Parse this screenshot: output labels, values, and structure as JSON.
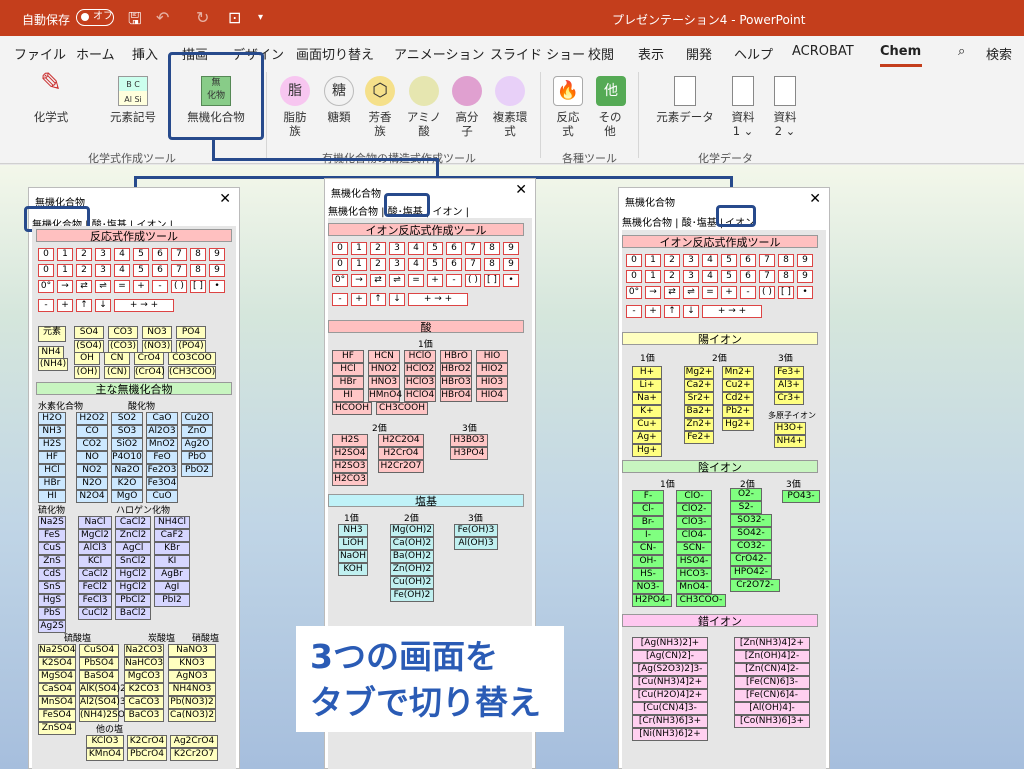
{
  "window": {
    "autosave_label": "自動保存",
    "autosave_state": "オフ",
    "title": "プレゼンテーション4 - PowerPoint"
  },
  "menu": [
    "ファイル",
    "ホーム",
    "挿入",
    "描画",
    "デザイン",
    "画面切り替え",
    "アニメーション",
    "スライド ショー",
    "校閲",
    "表示",
    "開発",
    "ヘルプ",
    "ACROBAT",
    "Chem",
    "検索"
  ],
  "ribbon": {
    "kagakushiki": "化学式",
    "genso_kigo": "元素記号",
    "muki": "無機化合物",
    "shibo": "脂肪",
    "shibo2": "族",
    "touruui": "糖類",
    "houkou": "芳香",
    "houkou2": "族",
    "amino": "アミノ",
    "amino2": "酸",
    "koubun": "高分",
    "koubun2": "子",
    "fukuso": "複素環",
    "fukuso2": "式",
    "hannou": "反応",
    "hannou2": "式",
    "sonota": "その",
    "sonota2": "他",
    "genso_data": "元素データ",
    "shiryo1": "資料",
    "shiryo1n": "1",
    "shiryo2": "資料",
    "shiryo2n": "2",
    "grp1": "化学式作成ツール",
    "grp2": "有機化合物の構造式作成ツール",
    "grp3": "各種ツール",
    "grp4": "化学データ",
    "ic_bc": "B C",
    "ic_alsi": "Al Si",
    "ic_muki": "無\n化物",
    "ic_shibo": "脂",
    "ic_tou": "糖",
    "ic_sonota": "他"
  },
  "pane1": {
    "title": "無機化合物",
    "tabs": "無機化合物 | 酸･塩基 | イオン |",
    "h1": "反応式作成ツール",
    "h2": "主な無機化合物",
    "keys": [
      "0",
      "1",
      "2",
      "3",
      "4",
      "5",
      "6",
      "7",
      "8",
      "9"
    ],
    "sym": [
      "0°",
      "→",
      "⇄",
      "⇌",
      "=",
      "+",
      "-",
      "( )",
      "[ ]",
      "•"
    ],
    "ops": [
      "-",
      "+",
      "↑",
      "↓",
      "+  →  +"
    ],
    "genso": "元素",
    "nh4": "NH4",
    "nh4p": "(NH4)",
    "ions": [
      "SO4",
      "CO3",
      "NO3",
      "PO4",
      "(SO4)",
      "(CO3)",
      "(NO3)",
      "(PO4)",
      "OH",
      "CN",
      "CrO4",
      "CO3COO",
      "(OH)",
      "(CN)",
      "(CrO4)",
      "(CH3COO)"
    ],
    "l_suiso": "水素化合物",
    "l_sanka": "酸化物",
    "l_ryuka": "硫化物",
    "l_halogen": "ハロゲン化物",
    "l_ryusan": "硫酸塩",
    "l_tansan": "炭酸塩",
    "l_shousan": "硝酸塩",
    "l_other": "他の塩",
    "suiso": [
      "H2O",
      "NH3",
      "H2S",
      "HF",
      "HCl",
      "HBr",
      "HI"
    ],
    "sanka": [
      "H2O2",
      "SO2",
      "CaO",
      "Cu2O",
      "CO",
      "SO3",
      "Al2O3",
      "ZnO",
      "CO2",
      "SiO2",
      "MnO2",
      "Ag2O",
      "NO",
      "P4O10",
      "FeO",
      "PbO",
      "NO2",
      "Na2O",
      "Fe2O3",
      "PbO2",
      "N2O",
      "K2O",
      "Fe3O4",
      "",
      "N2O4",
      "MgO",
      "CuO",
      ""
    ],
    "ryuka": [
      "Na2S",
      "FeS",
      "CuS",
      "ZnS",
      "CdS",
      "SnS",
      "HgS",
      "PbS",
      "Ag2S"
    ],
    "halogen": [
      "NaCl",
      "CaCl2",
      "NH4Cl",
      "MgCl2",
      "ZnCl2",
      "CaF2",
      "AlCl3",
      "AgCl",
      "KBr",
      "KCl",
      "SnCl2",
      "KI",
      "CaCl2",
      "HgCl2",
      "AgBr",
      "FeCl2",
      "HgCl2",
      "AgI",
      "FeCl3",
      "PbCl2",
      "PbI2",
      "CuCl2",
      "BaCl2",
      ""
    ],
    "ryusan": [
      "Na2SO4",
      "CuSO4",
      "K2SO4",
      "PbSO4",
      "MgSO4",
      "BaSO4",
      "CaSO4",
      "AlK(SO4)2",
      "MnSO4",
      "Al2(SO4)3",
      "FeSO4",
      "(NH4)2SO4",
      "ZnSO4",
      ""
    ],
    "tansan": [
      "Na2CO3",
      "NaHCO3",
      "MgCO3",
      "K2CO3",
      "CaCO3",
      "BaCO3"
    ],
    "shousan": [
      "NaNO3",
      "KNO3",
      "AgNO3",
      "NH4NO3",
      "Pb(NO3)2",
      "Ca(NO3)2"
    ],
    "other": [
      "KClO3",
      "K2CrO4",
      "Ag2CrO4",
      "KMnO4",
      "PbCrO4",
      "K2Cr2O7"
    ]
  },
  "pane2": {
    "title": "無機化合物",
    "tabs": "無機化合物 | 酸･塩基 | イオン |",
    "h1": "イオン反応式作成ツール",
    "h2": "酸",
    "h3": "塩基",
    "v1": "1価",
    "v2": "2価",
    "v3": "3価",
    "acid1": [
      "HF",
      "HCN",
      "HClO",
      "HBrO",
      "HIO",
      "HCl",
      "HNO2",
      "HClO2",
      "HBrO2",
      "HIO2",
      "HBr",
      "HNO3",
      "HClO3",
      "HBrO3",
      "HIO3",
      "HI",
      "HMnO4",
      "HClO4",
      "HBrO4",
      "HIO4",
      "HCOOH",
      "CH3COOH",
      "",
      "",
      ""
    ],
    "acid2": [
      "H2S",
      "H2C2O4",
      "H2SO4",
      "H2CrO4",
      "H2SO3",
      "H2Cr2O7",
      "H2CO3",
      ""
    ],
    "acid3": [
      "H3BO3",
      "H3PO4"
    ],
    "base1": [
      "NH3",
      "LiOH",
      "NaOH",
      "KOH"
    ],
    "base2": [
      "Mg(OH)2",
      "Ca(OH)2",
      "Ba(OH)2",
      "Zn(OH)2",
      "Cu(OH)2",
      "Fe(OH)2"
    ],
    "base3": [
      "Fe(OH)3",
      "Al(OH)3"
    ]
  },
  "pane3": {
    "title": "無機化合物",
    "tabs": "無機化合物 | 酸･塩基 |",
    "tab_ion": "イオン",
    "h1": "イオン反応式作成ツール",
    "h2": "陽イオン",
    "h3": "陰イオン",
    "h4": "錯イオン",
    "v1": "1価",
    "v2": "2価",
    "v3": "3価",
    "poly": "多原子イオン",
    "cat1": [
      "H+",
      "Li+",
      "Na+",
      "K+",
      "Cu+",
      "Ag+",
      "Hg+"
    ],
    "cat2": [
      "Mg2+",
      "Ca2+",
      "Sr2+",
      "Ba2+",
      "Zn2+",
      "Fe2+"
    ],
    "cat2b": [
      "Mn2+",
      "Cu2+",
      "Cd2+",
      "Pb2+",
      "Hg2+"
    ],
    "cat3": [
      "Fe3+",
      "Al3+",
      "Cr3+"
    ],
    "catp": [
      "H3O+",
      "NH4+"
    ],
    "an1": [
      "F-",
      "Cl-",
      "Br-",
      "I-",
      "CN-",
      "OH-",
      "HS-",
      "NO3-",
      "H2PO4-"
    ],
    "an1b": [
      "ClO-",
      "ClO2-",
      "ClO3-",
      "ClO4-",
      "SCN-",
      "HSO4-",
      "HCO3-",
      "MnO4-",
      "CH3COO-"
    ],
    "an2": [
      "O2-",
      "S2-",
      "SO32-",
      "SO42-",
      "CO32-",
      "CrO42-",
      "HPO42-",
      "Cr2O72-"
    ],
    "an3": [
      "PO43-"
    ],
    "cx1": [
      "[Ag(NH3)2]+",
      "[Ag(CN)2]-",
      "[Ag(S2O3)2]3-",
      "[Cu(NH3)4]2+",
      "[Cu(H2O)4]2+",
      "[Cu(CN)4]3-",
      "[Cr(NH3)6]3+",
      "[Ni(NH3)6]2+"
    ],
    "cx2": [
      "[Zn(NH3)4]2+",
      "[Zn(OH)4]2-",
      "[Zn(CN)4]2-",
      "[Fe(CN)6]3-",
      "[Fe(CN)6]4-",
      "[Al(OH)4]-",
      "[Co(NH3)6]3+"
    ]
  },
  "caption": {
    "line1": "3つの画面を",
    "line2": "タブで切り替え"
  }
}
